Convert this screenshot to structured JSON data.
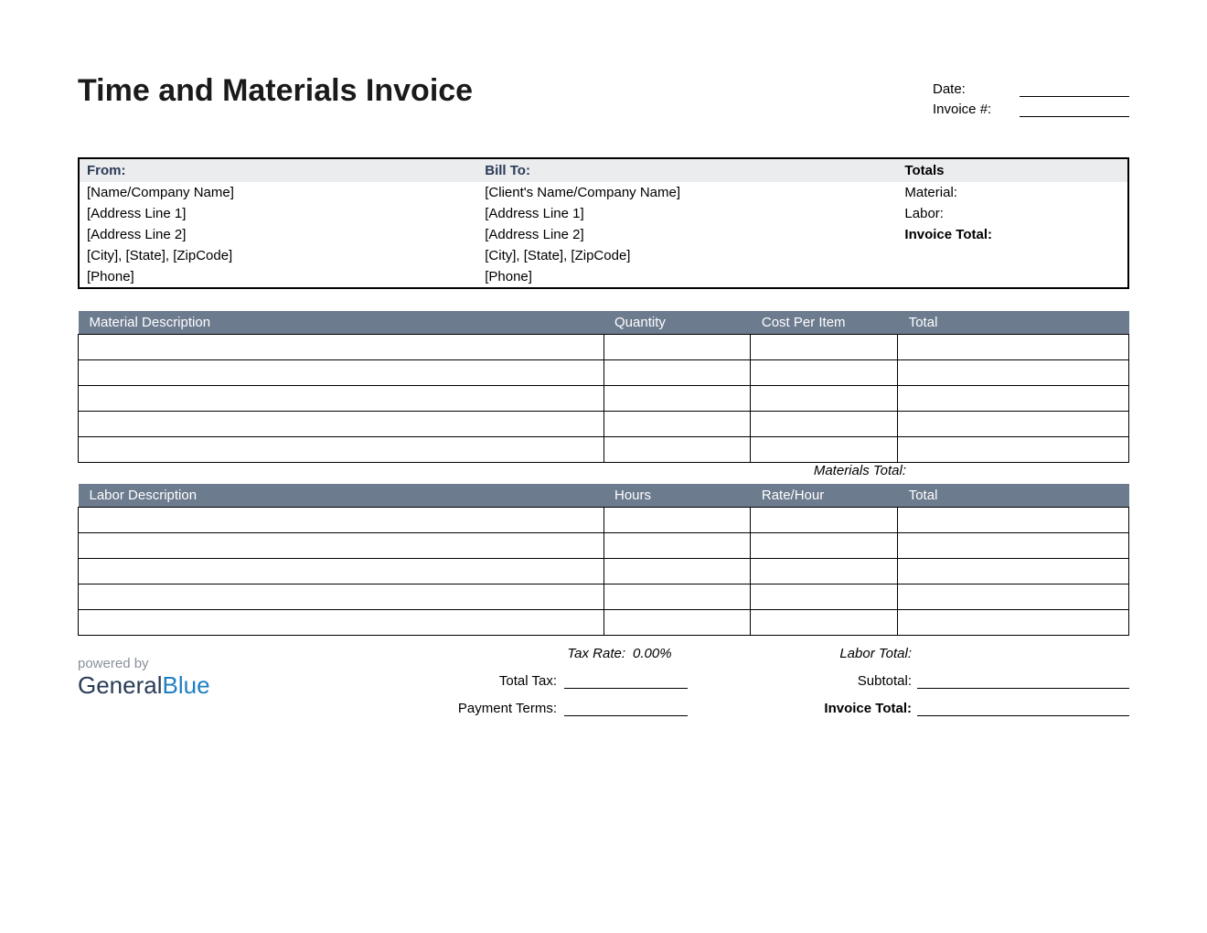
{
  "title": "Time and Materials Invoice",
  "meta": {
    "date_label": "Date:",
    "invoice_label": "Invoice #:"
  },
  "info": {
    "from_header": "From:",
    "billto_header": "Bill To:",
    "totals_header": "Totals",
    "from": {
      "name": "[Name/Company Name]",
      "addr1": "[Address Line 1]",
      "addr2": "[Address Line 2]",
      "city": "[City], [State], [ZipCode]",
      "phone": "[Phone]"
    },
    "billto": {
      "name": "[Client's Name/Company Name]",
      "addr1": "[Address Line 1]",
      "addr2": "[Address Line 2]",
      "city": "[City], [State], [ZipCode]",
      "phone": "[Phone]"
    },
    "totals": {
      "material": "Material:",
      "labor": "Labor:",
      "invoice_total": "Invoice Total:"
    }
  },
  "materials": {
    "headers": {
      "desc": "Material Description",
      "qty": "Quantity",
      "cost": "Cost Per Item",
      "total": "Total"
    },
    "total_label": "Materials Total:"
  },
  "labor": {
    "headers": {
      "desc": "Labor Description",
      "hours": "Hours",
      "rate": "Rate/Hour",
      "total": "Total"
    },
    "total_label": "Labor Total:"
  },
  "footer": {
    "powered": "powered by",
    "logo1": "General",
    "logo2": "Blue",
    "tax_rate_label": "Tax Rate:",
    "tax_rate_value": "0.00%",
    "total_tax_label": "Total Tax:",
    "payment_terms_label": "Payment Terms:",
    "subtotal_label": "Subtotal:",
    "invoice_total_label": "Invoice Total:"
  }
}
